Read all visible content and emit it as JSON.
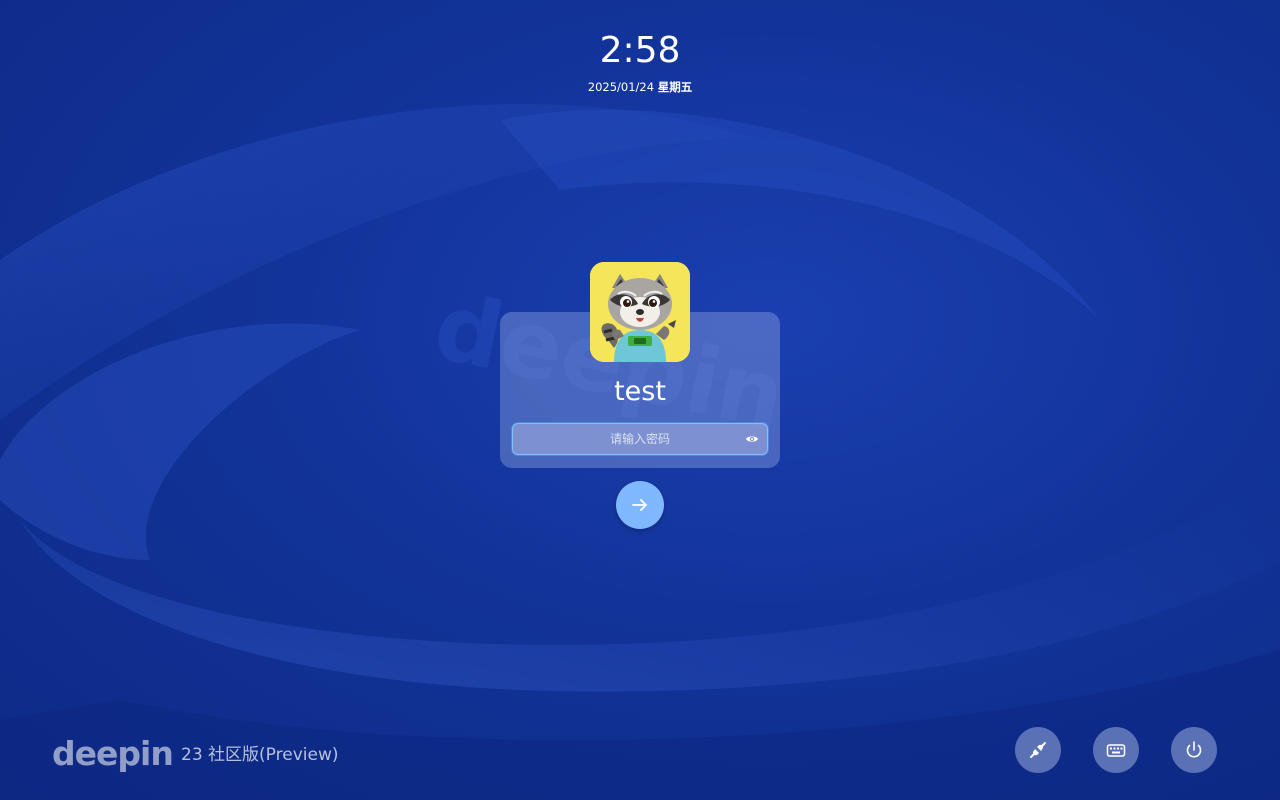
{
  "lock_screen": {
    "time": "2:58",
    "date": "2025/01/24",
    "weekday": "星期五"
  },
  "user": {
    "name": "test",
    "avatar": "raccoon-avatar"
  },
  "password": {
    "placeholder": "请输入密码",
    "value": "",
    "toggle_icon": "eye-icon"
  },
  "submit": {
    "icon": "arrow-right-icon"
  },
  "branding": {
    "logo": "deepin",
    "edition": "23 社区版(Preview)"
  },
  "tray": [
    {
      "icon": "network-plug-icon"
    },
    {
      "icon": "keyboard-icon"
    },
    {
      "icon": "power-icon"
    }
  ],
  "colors": {
    "background": "#123399",
    "accent": "#7fb8ff",
    "field_border": "#7fc2ff",
    "avatar_background": "#f4e55a"
  }
}
